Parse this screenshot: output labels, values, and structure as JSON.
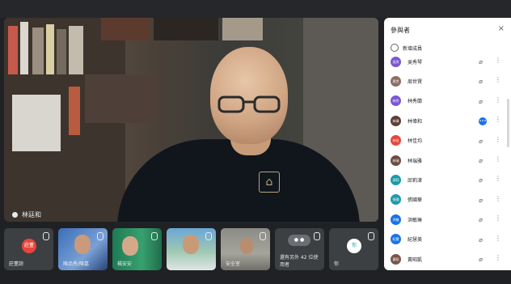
{
  "main_speaker": {
    "name": "林廷和"
  },
  "tiles": [
    {
      "name": "莊董諒",
      "avatar_text": "莊董",
      "avatar_color": "#e8453c"
    },
    {
      "name": "陳品秀/陳嘉",
      "type": "photo"
    },
    {
      "name": "楊安安",
      "type": "photo"
    },
    {
      "name": "",
      "type": "photo"
    },
    {
      "name": "安全室",
      "type": "photo"
    },
    {
      "name": "還有另外 42 位使用者",
      "type": "more"
    },
    {
      "name": "你",
      "avatar_text": "你",
      "avatar_color": "#ffffff"
    }
  ],
  "participants_panel": {
    "title": "參與者",
    "close_label": "×",
    "add_label": "新增成員",
    "items": [
      {
        "name": "吳秀琴",
        "color": "#7b57d1",
        "avatar_text": "吳秀"
      },
      {
        "name": "周世賢",
        "color": "#8d6e63",
        "avatar_text": "周世"
      },
      {
        "name": "林秀蘭",
        "color": "#7b57d1",
        "avatar_text": "林秀"
      },
      {
        "name": "林偉和",
        "color": "#5d4037",
        "avatar_text": "林偉",
        "presenting": true
      },
      {
        "name": "林佳均",
        "color": "#e8453c",
        "avatar_text": "林佳"
      },
      {
        "name": "林瑞雅",
        "color": "#6d4c41",
        "avatar_text": "林瑞"
      },
      {
        "name": "邱莉津",
        "color": "#1b9aaa",
        "avatar_text": "邱莉"
      },
      {
        "name": "張國華",
        "color": "#1b9aaa",
        "avatar_text": "張國"
      },
      {
        "name": "洪敏琳",
        "color": "#1a73e8",
        "avatar_text": "洪敏"
      },
      {
        "name": "紀慧美",
        "color": "#1a73e8",
        "avatar_text": "紀慧"
      },
      {
        "name": "黃昭凱",
        "color": "#795548",
        "avatar_text": "黃昭"
      }
    ]
  }
}
